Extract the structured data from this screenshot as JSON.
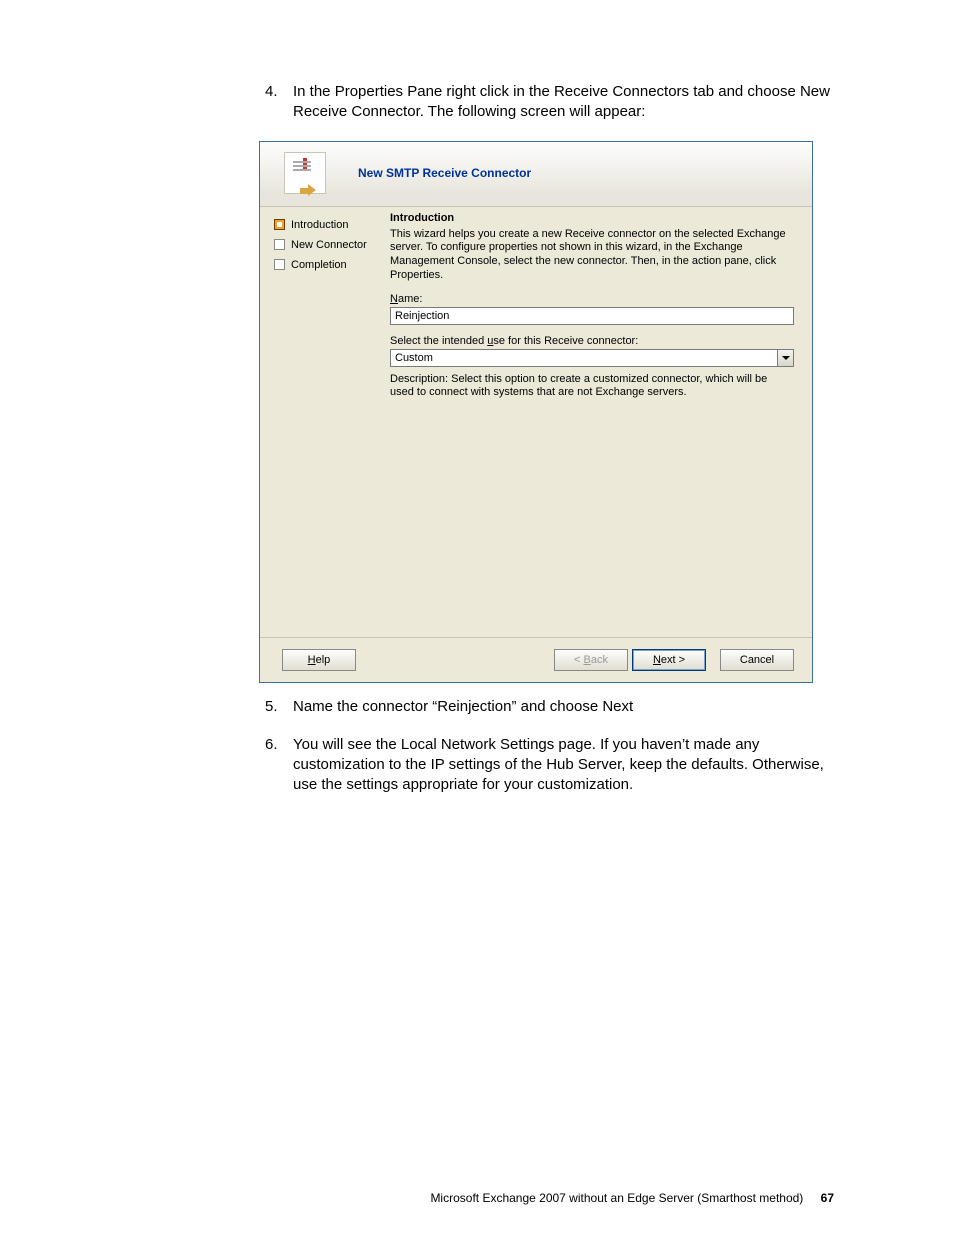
{
  "body": {
    "step4_num": "4.",
    "step4_text": "In the Properties Pane right click in the Receive Connectors tab and choose New Receive Connector. The following screen will appear:",
    "step5_num": "5.",
    "step5_text": "Name the connector “Reinjection” and choose Next",
    "step6_num": "6.",
    "step6_text": "You will see the Local Network Settings page. If you haven’t made any customization to the IP settings of the Hub Server, keep the defaults. Otherwise, use the settings appropriate for your customization."
  },
  "wizard": {
    "window_title": "New SMTP Receive Connector",
    "side_steps": [
      "Introduction",
      "New Connector",
      "Completion"
    ],
    "section_title": "Introduction",
    "section_desc": "This wizard helps you create a new Receive connector on the selected Exchange server. To configure properties not shown in this wizard, in the Exchange Management Console, select the new connector. Then, in the action pane, click Properties.",
    "name_label_pre": "N",
    "name_label_post": "ame:",
    "name_value": "Reinjection",
    "use_label_pre": "Select the intended ",
    "use_label_u": "u",
    "use_label_post": "se for this Receive connector:",
    "use_value": "Custom",
    "use_desc": "Description: Select this option to create a customized connector, which will be used to connect with systems that are not Exchange servers.",
    "btn_help_h": "H",
    "btn_help_rest": "elp",
    "btn_back_lt": "< ",
    "btn_back_b": "B",
    "btn_back_rest": "ack",
    "btn_next_n": "N",
    "btn_next_rest": "ext >",
    "btn_cancel": "Cancel"
  },
  "footer": {
    "text": "Microsoft Exchange 2007 without an Edge Server (Smarthost method)",
    "page": "67"
  }
}
